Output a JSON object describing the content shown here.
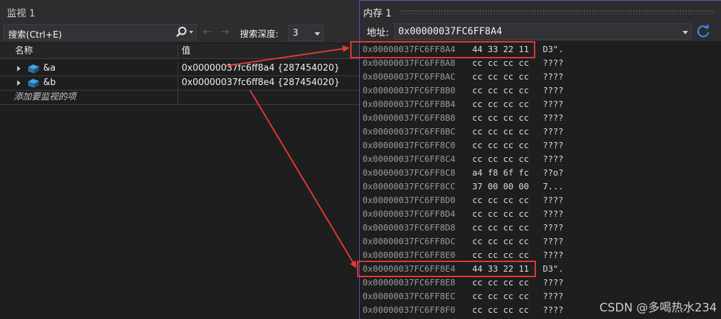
{
  "watch": {
    "title": "监视 1",
    "search_placeholder": "搜索(Ctrl+E)",
    "depth_label": "搜索深度:",
    "depth_value": "3",
    "columns": {
      "name": "名称",
      "value": "值"
    },
    "rows": [
      {
        "name": "&a",
        "value": "0x00000037fc6ff8a4 {287454020}"
      },
      {
        "name": "&b",
        "value": "0x00000037fc6ff8e4 {287454020}"
      }
    ],
    "add_item": "添加要监视的项"
  },
  "memory": {
    "title": "内存 1",
    "address_label": "地址:",
    "address_value": "0x00000037FC6FF8A4",
    "rows": [
      {
        "addr": "0x00000037FC6FF8A4",
        "bytes": "44 33 22 11",
        "text": "D3\"."
      },
      {
        "addr": "0x00000037FC6FF8A8",
        "bytes": "cc cc cc cc",
        "text": "????"
      },
      {
        "addr": "0x00000037FC6FF8AC",
        "bytes": "cc cc cc cc",
        "text": "????"
      },
      {
        "addr": "0x00000037FC6FF8B0",
        "bytes": "cc cc cc cc",
        "text": "????"
      },
      {
        "addr": "0x00000037FC6FF8B4",
        "bytes": "cc cc cc cc",
        "text": "????"
      },
      {
        "addr": "0x00000037FC6FF8B8",
        "bytes": "cc cc cc cc",
        "text": "????"
      },
      {
        "addr": "0x00000037FC6FF8BC",
        "bytes": "cc cc cc cc",
        "text": "????"
      },
      {
        "addr": "0x00000037FC6FF8C0",
        "bytes": "cc cc cc cc",
        "text": "????"
      },
      {
        "addr": "0x00000037FC6FF8C4",
        "bytes": "cc cc cc cc",
        "text": "????"
      },
      {
        "addr": "0x00000037FC6FF8C8",
        "bytes": "a4 f8 6f fc",
        "text": "??o?"
      },
      {
        "addr": "0x00000037FC6FF8CC",
        "bytes": "37 00 00 00",
        "text": "7..."
      },
      {
        "addr": "0x00000037FC6FF8D0",
        "bytes": "cc cc cc cc",
        "text": "????"
      },
      {
        "addr": "0x00000037FC6FF8D4",
        "bytes": "cc cc cc cc",
        "text": "????"
      },
      {
        "addr": "0x00000037FC6FF8D8",
        "bytes": "cc cc cc cc",
        "text": "????"
      },
      {
        "addr": "0x00000037FC6FF8DC",
        "bytes": "cc cc cc cc",
        "text": "????"
      },
      {
        "addr": "0x00000037FC6FF8E0",
        "bytes": "cc cc cc cc",
        "text": "????"
      },
      {
        "addr": "0x00000037FC6FF8E4",
        "bytes": "44 33 22 11",
        "text": "D3\"."
      },
      {
        "addr": "0x00000037FC6FF8E8",
        "bytes": "cc cc cc cc",
        "text": "????"
      },
      {
        "addr": "0x00000037FC6FF8EC",
        "bytes": "cc cc cc cc",
        "text": "????"
      },
      {
        "addr": "0x00000037FC6FF8F0",
        "bytes": "cc cc cc cc",
        "text": "????"
      }
    ]
  },
  "watermark": "CSDN @多喝热水234",
  "colors": {
    "annotation": "#e53935",
    "accent": "#0e70c0"
  }
}
